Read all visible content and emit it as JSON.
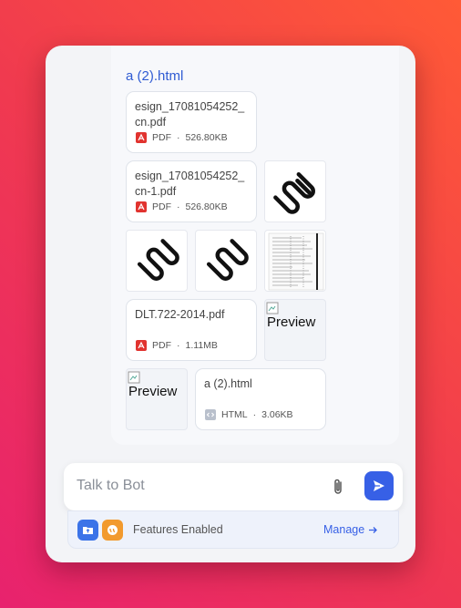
{
  "chat": {
    "title_link": "a (2).html",
    "files": [
      {
        "name": "esign_17081054252_cn.pdf",
        "type": "PDF",
        "size": "526.80KB"
      },
      {
        "name": "esign_17081054252_cn-1.pdf",
        "type": "PDF",
        "size": "526.80KB"
      },
      {
        "name": "DLT.722-2014.pdf",
        "type": "PDF",
        "size": "1.11MB"
      },
      {
        "name": "a (2).html",
        "type": "HTML",
        "size": "3.06KB"
      }
    ],
    "preview_alt": "Preview",
    "meta_separator": "·"
  },
  "input": {
    "placeholder": "Talk to Bot"
  },
  "features": {
    "label": "Features Enabled",
    "manage_label": "Manage"
  },
  "colors": {
    "accent": "#3760e6",
    "pdf_red": "#e1332f",
    "upload_blue": "#3b73e8",
    "quote_orange": "#f29a2e"
  },
  "icons": {
    "pdf": "pdf-icon",
    "html": "html-icon",
    "attach": "paperclip-icon",
    "send": "send-icon",
    "upload": "folder-upload-icon",
    "quote": "quote-icon",
    "arrow": "arrow-right-icon"
  }
}
